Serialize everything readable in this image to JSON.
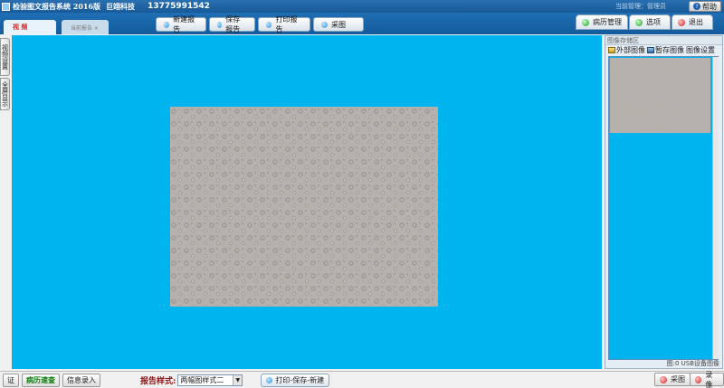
{
  "window": {
    "title": "检验图文报告系统 2016版",
    "company": "巨翊科技",
    "phone": "13775991542",
    "operator": "当前管理：管理员",
    "help_label": "帮助"
  },
  "tabs": [
    {
      "label": "视 频",
      "active": true
    },
    {
      "label": "当前报告 ×",
      "active": false
    }
  ],
  "toolbar": {
    "new_report": "新建报告",
    "save_report": "保存报告",
    "print_report": "打印报告",
    "capture": "采图"
  },
  "right_tabs": {
    "history": "病历管理",
    "options": "选项",
    "exit": "退出"
  },
  "side_tabs": [
    "视频设置",
    "全屏显示"
  ],
  "image_panel": {
    "header": "图像存储区",
    "external_image": "外部图像",
    "temp_save": "暂存图像",
    "image_settings": "图像设置",
    "footer": "图:0 USB设备图像"
  },
  "bottom": {
    "cert": "证",
    "quick_query": "病历速查",
    "info_entry": "信息录入",
    "report_style_label": "报告样式:",
    "report_style_value": "两幅图样式二",
    "print_save_new": "打印-保存-新建",
    "capture": "采图",
    "record": "录像"
  },
  "colors": {
    "workspace": "#00b4ef",
    "titlebar": "#175a98"
  }
}
